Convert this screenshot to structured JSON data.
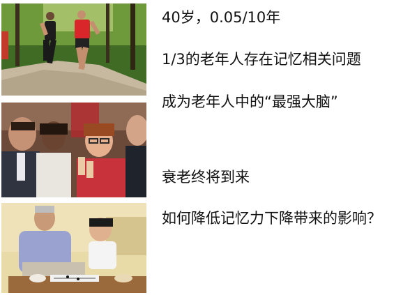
{
  "lines": [
    "40岁，0.05/10年",
    "1/3的老年人存在记忆相关问题",
    "成为老年人中的“最强大脑”",
    "衰老终将到来",
    "如何降低记忆力下降带来的影响？"
  ]
}
